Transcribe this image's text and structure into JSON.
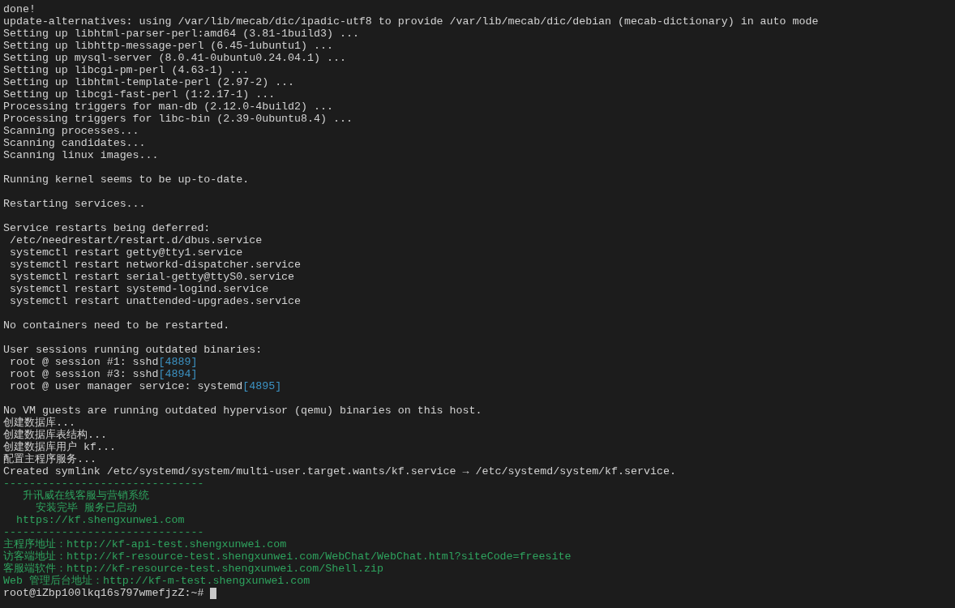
{
  "terminal": {
    "blocks": [
      {
        "lines": [
          {
            "segments": [
              {
                "kind": "plain",
                "text": "done!"
              }
            ]
          },
          {
            "segments": [
              {
                "kind": "plain",
                "text": "update-alternatives: using /var/lib/mecab/dic/ipadic-utf8 to provide /var/lib/mecab/dic/debian (mecab-dictionary) in auto mode"
              }
            ]
          },
          {
            "segments": [
              {
                "kind": "plain",
                "text": "Setting up libhtml-parser-perl:amd64 (3.81-1build3) ..."
              }
            ]
          },
          {
            "segments": [
              {
                "kind": "plain",
                "text": "Setting up libhttp-message-perl (6.45-1ubuntu1) ..."
              }
            ]
          },
          {
            "segments": [
              {
                "kind": "plain",
                "text": "Setting up mysql-server (8.0.41-0ubuntu0.24.04.1) ..."
              }
            ]
          },
          {
            "segments": [
              {
                "kind": "plain",
                "text": "Setting up libcgi-pm-perl (4.63-1) ..."
              }
            ]
          },
          {
            "segments": [
              {
                "kind": "plain",
                "text": "Setting up libhtml-template-perl (2.97-2) ..."
              }
            ]
          },
          {
            "segments": [
              {
                "kind": "plain",
                "text": "Setting up libcgi-fast-perl (1:2.17-1) ..."
              }
            ]
          },
          {
            "segments": [
              {
                "kind": "plain",
                "text": "Processing triggers for man-db (2.12.0-4build2) ..."
              }
            ]
          },
          {
            "segments": [
              {
                "kind": "plain",
                "text": "Processing triggers for libc-bin (2.39-0ubuntu8.4) ..."
              }
            ]
          },
          {
            "segments": [
              {
                "kind": "plain",
                "text": "Scanning processes..."
              }
            ]
          },
          {
            "segments": [
              {
                "kind": "plain",
                "text": "Scanning candidates..."
              }
            ]
          },
          {
            "segments": [
              {
                "kind": "plain",
                "text": "Scanning linux images..."
              }
            ]
          }
        ]
      },
      {
        "lines": [
          {
            "segments": [
              {
                "kind": "plain",
                "text": "Running kernel seems to be up-to-date."
              }
            ]
          }
        ]
      },
      {
        "lines": [
          {
            "segments": [
              {
                "kind": "plain",
                "text": "Restarting services..."
              }
            ]
          }
        ]
      },
      {
        "lines": [
          {
            "segments": [
              {
                "kind": "plain",
                "text": "Service restarts being deferred:"
              }
            ]
          },
          {
            "segments": [
              {
                "kind": "plain",
                "text": " /etc/needrestart/restart.d/dbus.service"
              }
            ]
          },
          {
            "segments": [
              {
                "kind": "plain",
                "text": " systemctl restart getty@tty1.service"
              }
            ]
          },
          {
            "segments": [
              {
                "kind": "plain",
                "text": " systemctl restart networkd-dispatcher.service"
              }
            ]
          },
          {
            "segments": [
              {
                "kind": "plain",
                "text": " systemctl restart serial-getty@ttyS0.service"
              }
            ]
          },
          {
            "segments": [
              {
                "kind": "plain",
                "text": " systemctl restart systemd-logind.service"
              }
            ]
          },
          {
            "segments": [
              {
                "kind": "plain",
                "text": " systemctl restart unattended-upgrades.service"
              }
            ]
          }
        ]
      },
      {
        "lines": [
          {
            "segments": [
              {
                "kind": "plain",
                "text": "No containers need to be restarted."
              }
            ]
          }
        ]
      },
      {
        "lines": [
          {
            "segments": [
              {
                "kind": "plain",
                "text": "User sessions running outdated binaries:"
              }
            ]
          },
          {
            "segments": [
              {
                "kind": "plain",
                "text": " root @ session #1: sshd"
              },
              {
                "kind": "pid",
                "text": "[4889]"
              }
            ]
          },
          {
            "segments": [
              {
                "kind": "plain",
                "text": " root @ session #3: sshd"
              },
              {
                "kind": "pid",
                "text": "[4894]"
              }
            ]
          },
          {
            "segments": [
              {
                "kind": "plain",
                "text": " root @ user manager service: systemd"
              },
              {
                "kind": "pid",
                "text": "[4895]"
              }
            ]
          }
        ]
      },
      {
        "lines": [
          {
            "segments": [
              {
                "kind": "plain",
                "text": "No VM guests are running outdated hypervisor (qemu) binaries on this host."
              }
            ]
          },
          {
            "segments": [
              {
                "kind": "plain",
                "text": "创建数据库..."
              }
            ]
          },
          {
            "segments": [
              {
                "kind": "plain",
                "text": "创建数据库表结构..."
              }
            ]
          },
          {
            "segments": [
              {
                "kind": "plain",
                "text": "创建数据库用户 kf..."
              }
            ]
          },
          {
            "segments": [
              {
                "kind": "plain",
                "text": "配置主程序服务..."
              }
            ]
          },
          {
            "segments": [
              {
                "kind": "plain",
                "text": "Created symlink /etc/systemd/system/multi-user.target.wants/kf.service → /etc/systemd/system/kf.service."
              }
            ]
          },
          {
            "segments": [
              {
                "kind": "accent",
                "text": "-------------------------------"
              }
            ]
          },
          {
            "segments": [
              {
                "kind": "accent",
                "text": "   升讯威在线客服与营销系统"
              }
            ]
          },
          {
            "segments": [
              {
                "kind": "accent",
                "text": "     安装完毕 服务已启动"
              }
            ]
          },
          {
            "segments": [
              {
                "kind": "accent",
                "text": "  https://kf.shengxunwei.com"
              }
            ]
          },
          {
            "segments": [
              {
                "kind": "accent",
                "text": "-------------------------------"
              }
            ]
          },
          {
            "segments": [
              {
                "kind": "accent",
                "text": "主程序地址：http://kf-api-test.shengxunwei.com"
              }
            ]
          },
          {
            "segments": [
              {
                "kind": "accent",
                "text": "访客端地址：http://kf-resource-test.shengxunwei.com/WebChat/WebChat.html?siteCode=freesite"
              }
            ]
          },
          {
            "segments": [
              {
                "kind": "accent",
                "text": "客服端软件：http://kf-resource-test.shengxunwei.com/Shell.zip"
              }
            ]
          },
          {
            "segments": [
              {
                "kind": "accent",
                "text": "Web 管理后台地址：http://kf-m-test.shengxunwei.com"
              }
            ]
          },
          {
            "segments": [
              {
                "kind": "prompt",
                "text": "root@iZbp100lkq16s797wmefjzZ:~# "
              }
            ],
            "cursor": true
          }
        ]
      }
    ]
  }
}
